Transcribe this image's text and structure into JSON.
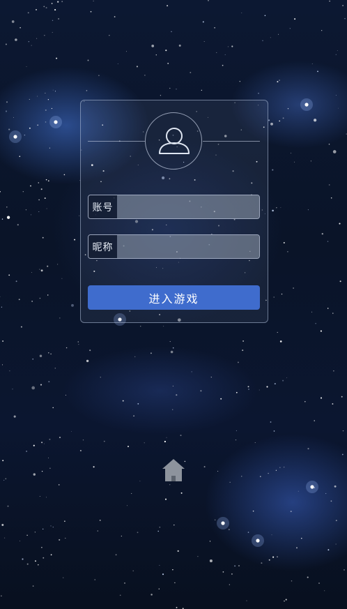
{
  "login": {
    "account_label": "账号",
    "account_value": "",
    "nickname_label": "昵称",
    "nickname_value": "",
    "enter_button": "进入游戏"
  },
  "icons": {
    "avatar": "user-icon",
    "home": "home-icon"
  },
  "colors": {
    "button": "#3f6ccd",
    "background": "#0a1428"
  }
}
